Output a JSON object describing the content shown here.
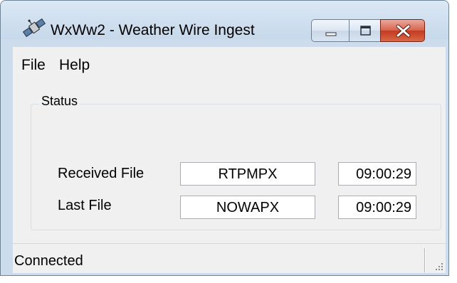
{
  "window": {
    "title": "WxWw2 - Weather Wire Ingest",
    "app_icon": "satellite-icon",
    "controls": {
      "minimize": "minimize-icon",
      "maximize": "maximize-icon",
      "close": "close-icon"
    }
  },
  "menu": {
    "items": [
      {
        "label": "File"
      },
      {
        "label": "Help"
      }
    ]
  },
  "status_group": {
    "label": "Status",
    "rows": [
      {
        "label": "Received File",
        "file": "RTPMPX",
        "time": "09:00:29"
      },
      {
        "label": "Last File",
        "file": "NOWAPX",
        "time": "09:00:29"
      }
    ]
  },
  "statusbar": {
    "text": "Connected",
    "grip_icon": "resize-grip-icon"
  },
  "colors": {
    "frame": "#ccdcec",
    "client": "#f0f0f0",
    "close_button": "#c4391f"
  }
}
